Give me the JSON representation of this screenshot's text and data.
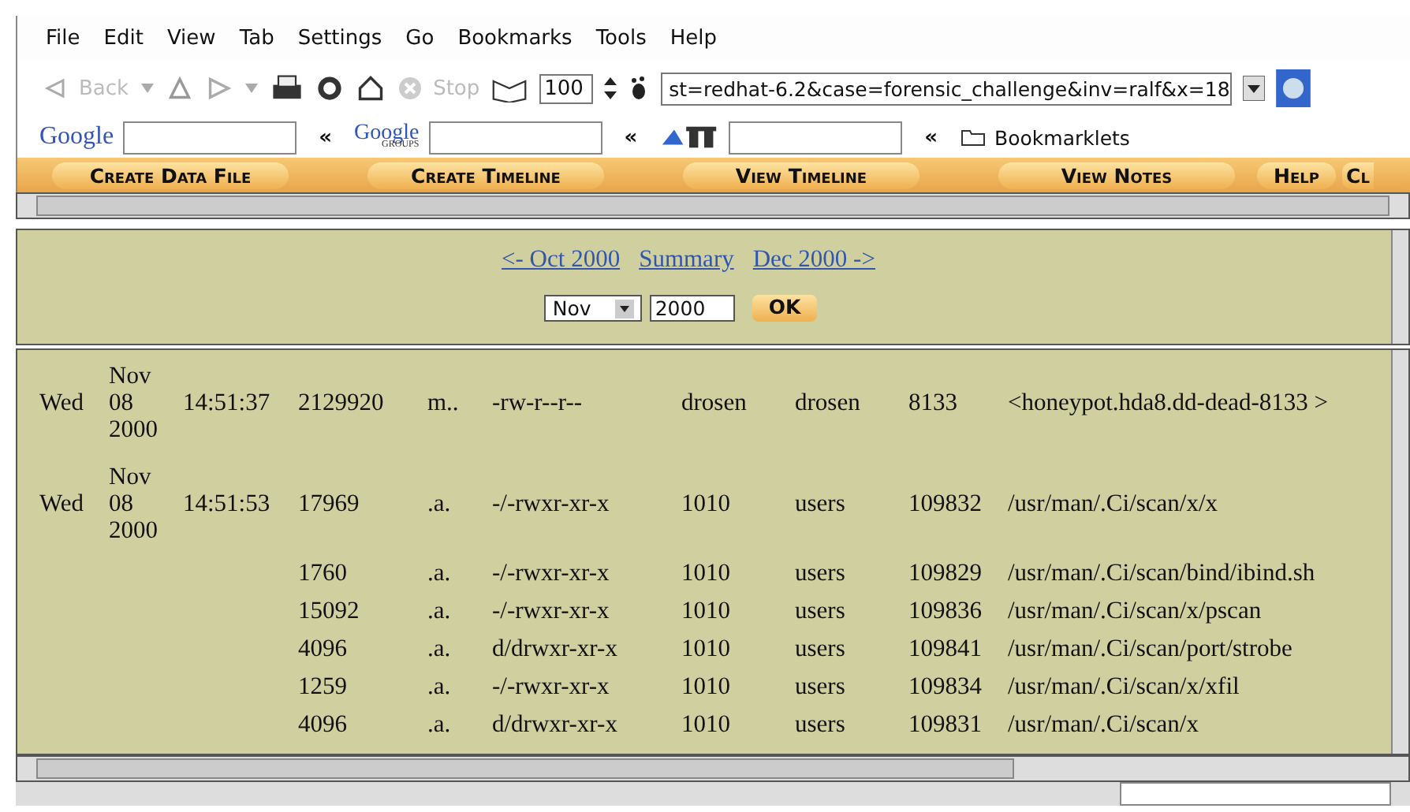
{
  "menu": [
    "File",
    "Edit",
    "View",
    "Tab",
    "Settings",
    "Go",
    "Bookmarks",
    "Tools",
    "Help"
  ],
  "toolbar": {
    "back": "Back",
    "stop": "Stop",
    "zoom": "100",
    "url": "st=redhat-6.2&case=forensic_challenge&inv=ralf&x=18"
  },
  "search_bar": {
    "google": "Google",
    "groups": "Google",
    "groups_sub": "GROUPS",
    "bookmarklets": "Bookmarklets",
    "chevron": "«"
  },
  "nav_buttons": [
    "Create Data File",
    "Create Timeline",
    "View Timeline",
    "View Notes",
    "Help",
    "Cl"
  ],
  "month_nav": {
    "prev": "<- Oct 2000",
    "summary": "Summary",
    "next": "Dec 2000 ->",
    "month": "Nov",
    "year": "2000",
    "ok": "OK"
  },
  "rows": [
    {
      "day": "Wed",
      "date": "Nov 08 2000",
      "time": "14:51:37",
      "size": "2129920",
      "activity": "m..",
      "perms": "-rw-r--r--",
      "uid": "drosen",
      "gid": "drosen",
      "inode": "8133",
      "file": "<honeypot.hda8.dd-dead-8133 >"
    },
    {
      "day": "Wed",
      "date": "Nov 08 2000",
      "time": "14:51:53",
      "size": "17969",
      "activity": ".a.",
      "perms": "-/-rwxr-xr-x",
      "uid": "1010",
      "gid": "users",
      "inode": "109832",
      "file": "/usr/man/.Ci/scan/x/x"
    },
    {
      "size": "1760",
      "activity": ".a.",
      "perms": "-/-rwxr-xr-x",
      "uid": "1010",
      "gid": "users",
      "inode": "109829",
      "file": "/usr/man/.Ci/scan/bind/ibind.sh"
    },
    {
      "size": "15092",
      "activity": ".a.",
      "perms": "-/-rwxr-xr-x",
      "uid": "1010",
      "gid": "users",
      "inode": "109836",
      "file": "/usr/man/.Ci/scan/x/pscan"
    },
    {
      "size": "4096",
      "activity": ".a.",
      "perms": "d/drwxr-xr-x",
      "uid": "1010",
      "gid": "users",
      "inode": "109841",
      "file": "/usr/man/.Ci/scan/port/strobe"
    },
    {
      "size": "1259",
      "activity": ".a.",
      "perms": "-/-rwxr-xr-x",
      "uid": "1010",
      "gid": "users",
      "inode": "109834",
      "file": "/usr/man/.Ci/scan/x/xfil"
    },
    {
      "size": "4096",
      "activity": ".a.",
      "perms": "d/drwxr-xr-x",
      "uid": "1010",
      "gid": "users",
      "inode": "109831",
      "file": "/usr/man/.Ci/scan/x"
    }
  ]
}
